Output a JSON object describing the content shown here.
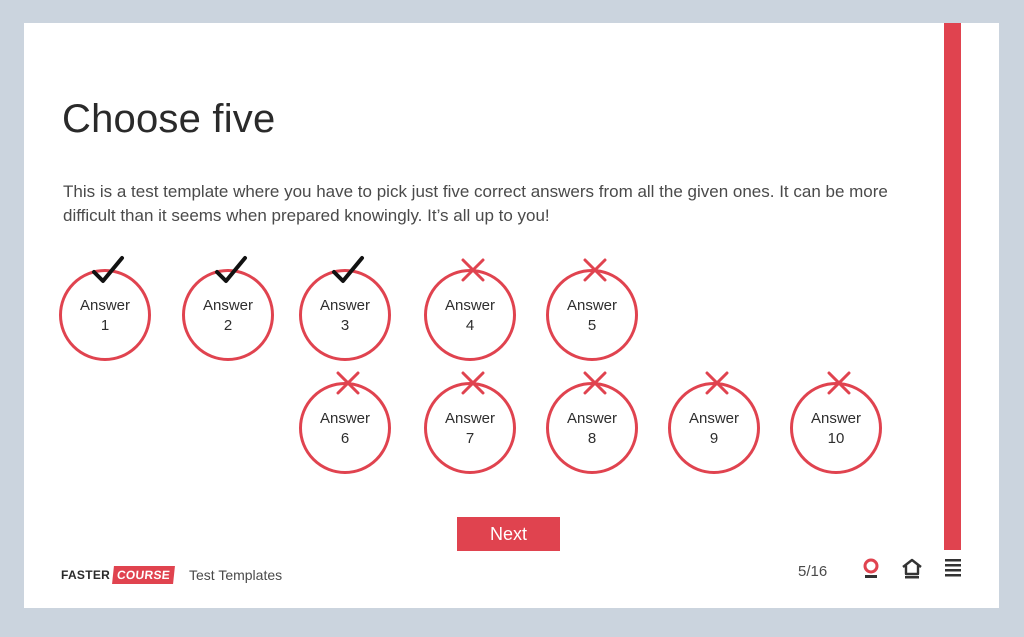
{
  "slide": {
    "title": "Choose five",
    "description": "This is a test template where you have to pick just five correct answers from all the given ones. It can be more difficult than it seems when prepared knowingly. It’s all up to you!"
  },
  "answers": [
    {
      "label": "Answer\n1",
      "mark": "check"
    },
    {
      "label": "Answer\n2",
      "mark": "check"
    },
    {
      "label": "Answer\n3",
      "mark": "check"
    },
    {
      "label": "Answer\n4",
      "mark": "cross"
    },
    {
      "label": "Answer\n5",
      "mark": "cross"
    },
    {
      "label": "Answer\n6",
      "mark": "cross"
    },
    {
      "label": "Answer\n7",
      "mark": "cross"
    },
    {
      "label": "Answer\n8",
      "mark": "cross"
    },
    {
      "label": "Answer\n9",
      "mark": "cross"
    },
    {
      "label": "Answer\n10",
      "mark": "cross"
    }
  ],
  "next_button": {
    "label": "Next"
  },
  "footer": {
    "logo_left": "FASTER",
    "logo_right": "COURSE",
    "course_name": "Test Templates",
    "page_counter": "5/16",
    "icons": [
      "lifebuoy-icon",
      "home-icon",
      "menu-icon"
    ]
  },
  "colors": {
    "accent": "#e0434f",
    "background": "#cbd4de",
    "slide": "#ffffff",
    "check": "#111111"
  }
}
